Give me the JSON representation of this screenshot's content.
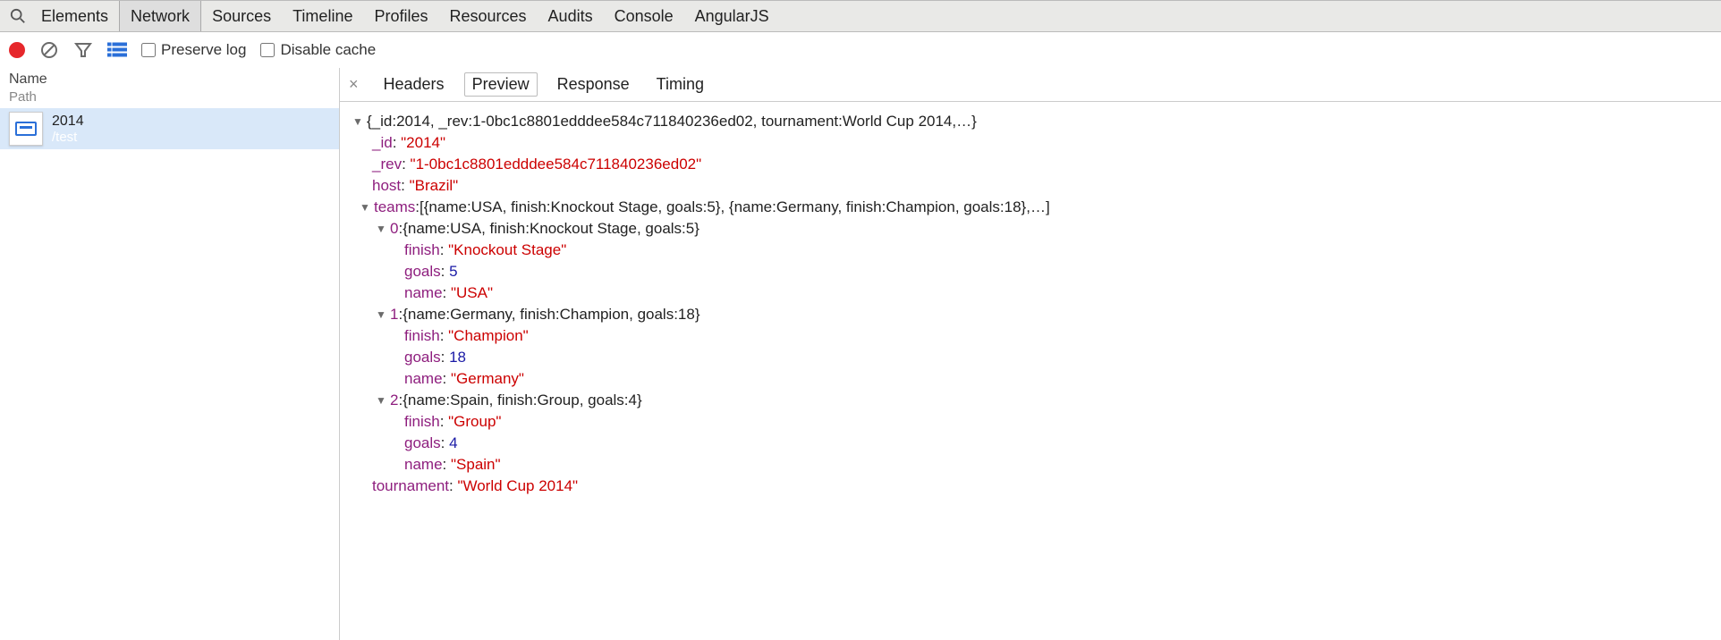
{
  "tabs": [
    "Elements",
    "Network",
    "Sources",
    "Timeline",
    "Profiles",
    "Resources",
    "Audits",
    "Console",
    "AngularJS"
  ],
  "activeTab": "Network",
  "toolbar": {
    "preserveLog": "Preserve log",
    "disableCache": "Disable cache"
  },
  "leftHeader": {
    "name": "Name",
    "path": "Path"
  },
  "request": {
    "name": "2014",
    "path": "/test"
  },
  "detailTabs": [
    "Headers",
    "Preview",
    "Response",
    "Timing"
  ],
  "activeDetailTab": "Preview",
  "json": {
    "top_summary": "{_id:2014, _rev:1-0bc1c8801edddee584c711840236ed02, tournament:World Cup 2014,…}",
    "k_id": "_id",
    "v_id": "\"2014\"",
    "k_rev": "_rev",
    "v_rev": "\"1-0bc1c8801edddee584c711840236ed02\"",
    "k_host": "host",
    "v_host": "\"Brazil\"",
    "k_teams": "teams",
    "teams_summary": "[{name:USA, finish:Knockout Stage, goals:5}, {name:Germany, finish:Champion, goals:18},…]",
    "teams": [
      {
        "idx": "0",
        "summary": "{name:USA, finish:Knockout Stage, goals:5}",
        "finish": "\"Knockout Stage\"",
        "goals": "5",
        "name": "\"USA\""
      },
      {
        "idx": "1",
        "summary": "{name:Germany, finish:Champion, goals:18}",
        "finish": "\"Champion\"",
        "goals": "18",
        "name": "\"Germany\""
      },
      {
        "idx": "2",
        "summary": "{name:Spain, finish:Group, goals:4}",
        "finish": "\"Group\"",
        "goals": "4",
        "name": "\"Spain\""
      }
    ],
    "k_finish": "finish",
    "k_goals": "goals",
    "k_name": "name",
    "k_tournament": "tournament",
    "v_tournament": "\"World Cup 2014\""
  }
}
